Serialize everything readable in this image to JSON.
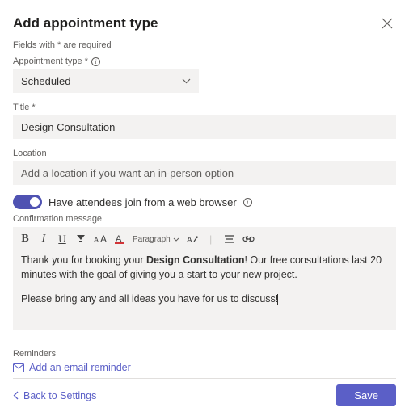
{
  "header": {
    "title": "Add appointment type"
  },
  "required_note": "Fields with * are required",
  "fields": {
    "appointment_type_label": "Appointment type *",
    "appointment_type_value": "Scheduled",
    "title_label": "Title *",
    "title_value": "Design Consultation",
    "location_label": "Location",
    "location_placeholder": "Add a location if you want an in-person option"
  },
  "toggle": {
    "label": "Have attendees join from a web browser"
  },
  "confirmation": {
    "label": "Confirmation message",
    "toolbar": {
      "paragraph": "Paragraph"
    },
    "body_pre": "Thank you for booking your ",
    "body_bold": "Design Consultation",
    "body_post": "! Our free consultations last 20 minutes with the goal of giving you a start to your new project.",
    "body_line2": "Please bring any and all ideas you have for us to discuss!"
  },
  "reminders": {
    "label": "Reminders",
    "add_link": "Add an email reminder"
  },
  "footer": {
    "back": "Back to Settings",
    "save": "Save"
  }
}
